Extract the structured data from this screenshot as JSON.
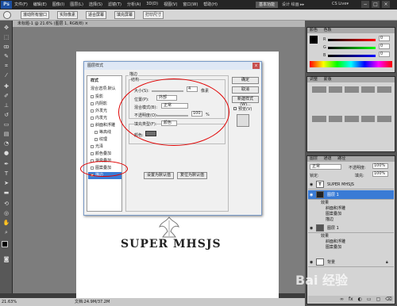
{
  "menubar": {
    "logo": "Ps",
    "items": [
      "文件(F)",
      "编辑(E)",
      "图像(I)",
      "图层(L)",
      "选择(S)",
      "滤镜(T)",
      "分析(A)",
      "3D(D)",
      "视图(V)",
      "窗口(W)",
      "帮助(H)"
    ],
    "workspace": "基本功能",
    "workspace2": "设计 绘画 ▸▸",
    "cslive": "CS Live▾",
    "win_min": "−",
    "win_max": "□",
    "win_close": "×"
  },
  "options": {
    "btn1": "滚动所有窗口",
    "btn2": "实际像素",
    "btn3": "适合屏幕",
    "btn4": "填充屏幕",
    "btn5": "打印尺寸"
  },
  "doctab": {
    "label": "未标题-1 @ 21.6% (图层 1, RGB/8) ×"
  },
  "statusbar": {
    "zoom": "21.63%",
    "doc": "文档:24.9M/37.2M"
  },
  "document": {
    "logo_text": "SUPER MHSJS"
  },
  "dialog": {
    "title": "图层样式",
    "close": "x",
    "styles_header": "样式",
    "blend_default": "混合选项:默认",
    "styles": [
      {
        "label": "投影"
      },
      {
        "label": "内阴影"
      },
      {
        "label": "外发光"
      },
      {
        "label": "内发光"
      },
      {
        "label": "斜面和浮雕"
      },
      {
        "label": "等高线"
      },
      {
        "label": "纹理"
      },
      {
        "label": "光泽"
      },
      {
        "label": "颜色叠加"
      },
      {
        "label": "渐变叠加"
      },
      {
        "label": "图案叠加"
      },
      {
        "label": "描边"
      }
    ],
    "selected_style": "描边",
    "section_title": "描边",
    "structure_title": "结构",
    "size_label": "大小(S):",
    "size_value": "4",
    "size_unit": "像素",
    "position_label": "位置(P):",
    "position_value": "外部",
    "blend_label": "混合模式(B):",
    "blend_value": "正常",
    "opacity_label": "不透明度(O):",
    "opacity_value": "100",
    "opacity_unit": "%",
    "fill_type_label": "填充类型(F):",
    "fill_type_value": "颜色",
    "color_label": "颜色:",
    "set_default": "设置为默认值",
    "reset_default": "复位为默认值",
    "ok": "确定",
    "cancel": "取消",
    "new_style": "新建样式(W)...",
    "preview_label": "预览(V)"
  },
  "right": {
    "color_tab": "颜色",
    "swatches_tab": "色板",
    "r": "R",
    "g": "G",
    "b": "B",
    "r_val": "0",
    "g_val": "0",
    "b_val": "0",
    "adjust_tab": "调整",
    "masks_tab": "蒙版",
    "layers_tab": "图层",
    "channels_tab": "通道",
    "paths_tab": "路径",
    "blend_mode": "正常",
    "opacity_label": "不透明度:",
    "opacity_value": "100%",
    "lock_label": "锁定:",
    "fill_label": "填充:",
    "fill_value": "100%",
    "layers": [
      {
        "name": "SUPER MHSJS",
        "type": "text"
      },
      {
        "name": "图层 1",
        "type": "image",
        "selected": true
      },
      {
        "name": "效果",
        "type": "effect"
      },
      {
        "name": "斜面和浮雕",
        "type": "effect"
      },
      {
        "name": "图案叠加",
        "type": "effect"
      },
      {
        "name": "描边",
        "type": "effect"
      },
      {
        "name": "图层 1",
        "type": "image"
      },
      {
        "name": "效果",
        "type": "effect"
      },
      {
        "name": "斜面和浮雕",
        "type": "effect"
      },
      {
        "name": "图案叠加",
        "type": "effect"
      },
      {
        "name": "背景",
        "type": "bg"
      }
    ]
  },
  "watermark": "Bai 经验",
  "colors": {
    "selection": "#3a7bd5",
    "annotation": "#e10000",
    "stroke_swatch": "#6e6e6e"
  }
}
